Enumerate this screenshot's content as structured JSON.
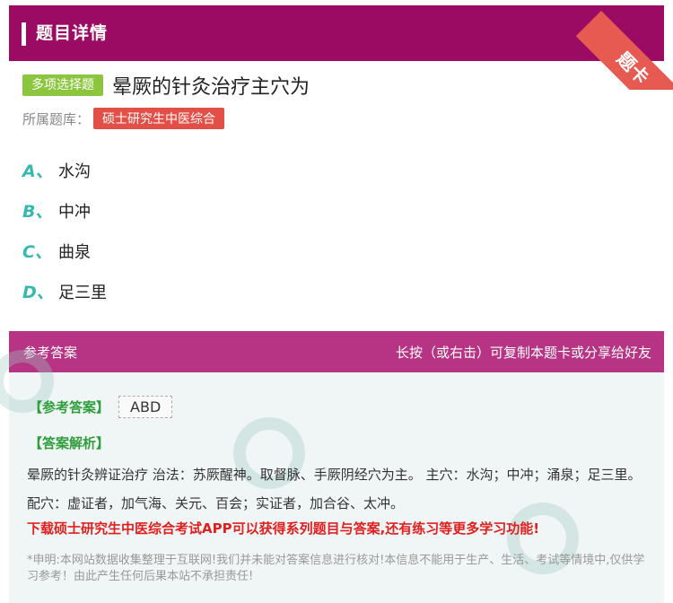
{
  "header": {
    "title": "题目详情",
    "ribbon": "题卡"
  },
  "question": {
    "type_tag": "多项选择题",
    "text": "晕厥的针灸治疗主穴为",
    "bank_label": "所属题库：",
    "bank_name": "硕士研究生中医综合"
  },
  "options": [
    {
      "letter": "A、",
      "text": "水沟"
    },
    {
      "letter": "B、",
      "text": "中冲"
    },
    {
      "letter": "C、",
      "text": "曲泉"
    },
    {
      "letter": "D、",
      "text": "足三里"
    }
  ],
  "answer_header": {
    "left": "参考答案",
    "right": "长按（或右击）可复制本题卡或分享给好友"
  },
  "answer": {
    "ref_label": "【参考答案】",
    "ref_value": "ABD",
    "analysis_label": "【答案解析】",
    "analysis": "晕厥的针灸辨证治疗 治法：苏厥醒神。取督脉、手厥阴经穴为主。 主穴：水沟；中冲；涌泉；足三里。 配穴：虚证者，加气海、关元、百会；实证者，加合谷、太冲。",
    "download": "下载硕士研究生中医综合考试APP可以获得系列题目与答案,还有练习等更多学习功能!",
    "disclaimer": "*申明:本网站数据收集整理于互联网!我们并未能对答案信息进行核对!本信息不能用于生产、生活、考试等情境中,仅供学习参考！由此产生任何后果本站不承担责任!"
  },
  "colors": {
    "header": "#9b0b63",
    "answer_header": "#b63483",
    "option_letter": "#38b8b0",
    "type_tag": "#8cc63e",
    "bank_tag": "#e14f47"
  }
}
